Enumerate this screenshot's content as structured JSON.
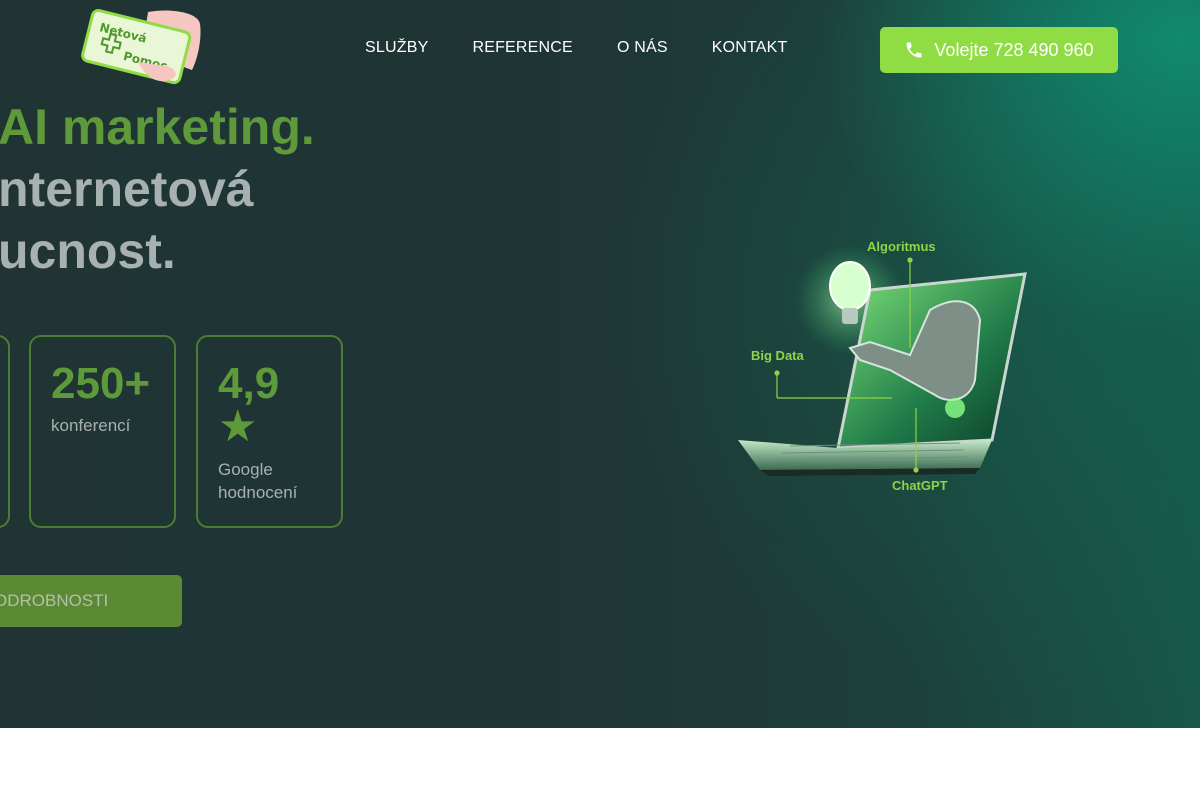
{
  "logo": {
    "line1": "Netová",
    "line2": "Pomoc"
  },
  "nav": {
    "items": [
      "SLUŽBY",
      "REFERENCE",
      "O NÁS",
      "KONTAKT"
    ]
  },
  "call_button": {
    "label": "Volejte 728 490 960",
    "icon": "phone-icon"
  },
  "hero": {
    "line1": "AI marketing.",
    "line2": "nternetová",
    "line3": "ucnost."
  },
  "stats": [
    {
      "value": "250+",
      "label": "konferencí"
    },
    {
      "value": "4,9",
      "star": "★",
      "label": "Google hodnocení"
    }
  ],
  "details_button": {
    "label": "ODROBNOSTI"
  },
  "illustration": {
    "labels": {
      "algoritmus": "Algoritmus",
      "big_data": "Big Data",
      "chatgpt": "ChatGPT"
    }
  },
  "colors": {
    "accent": "#8fdc45",
    "green_text": "#5f9a3a",
    "hero_bg": "#1f3434"
  }
}
